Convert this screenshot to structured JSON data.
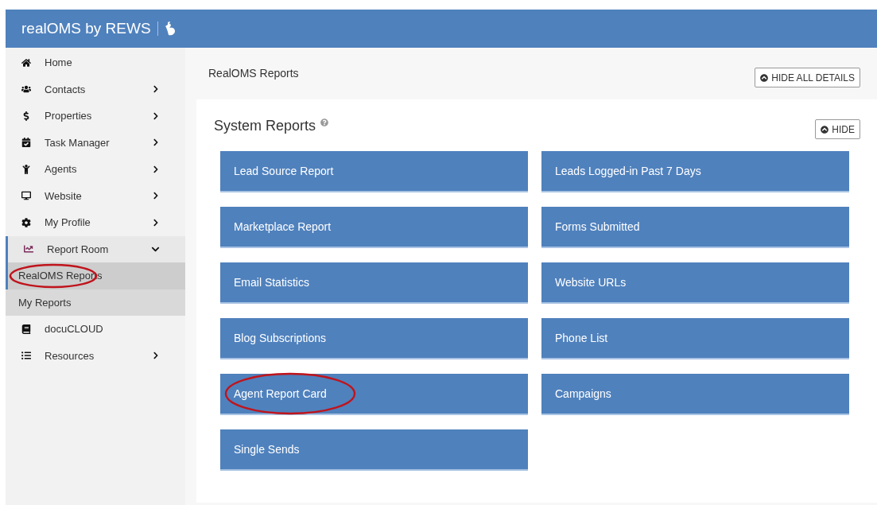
{
  "header": {
    "brand": "realOMS by REWS"
  },
  "sidebar": {
    "items": [
      {
        "label": "Home"
      },
      {
        "label": "Contacts",
        "expanded": false
      },
      {
        "label": "Properties",
        "expanded": false
      },
      {
        "label": "Task Manager",
        "expanded": false
      },
      {
        "label": "Agents",
        "expanded": false
      },
      {
        "label": "Website",
        "expanded": false
      },
      {
        "label": "My Profile",
        "expanded": false
      },
      {
        "label": "Report Room",
        "expanded": true,
        "children": [
          {
            "label": "RealOMS Reports",
            "selected": true,
            "circled": true
          },
          {
            "label": "My Reports",
            "selected": false,
            "circled": false
          }
        ]
      },
      {
        "label": "docuCLOUD"
      },
      {
        "label": "Resources",
        "expanded": false
      }
    ]
  },
  "page": {
    "breadcrumb": "RealOMS Reports",
    "hide_all_button": "HIDE ALL DETAILS"
  },
  "panel": {
    "title": "System Reports",
    "hide_button": "HIDE",
    "reports": [
      {
        "label": "Lead Source Report",
        "circled": false
      },
      {
        "label": "Leads Logged-in Past 7 Days",
        "circled": false
      },
      {
        "label": "Marketplace Report",
        "circled": false
      },
      {
        "label": "Forms Submitted",
        "circled": false
      },
      {
        "label": "Email Statistics",
        "circled": false
      },
      {
        "label": "Website URLs",
        "circled": false
      },
      {
        "label": "Blog Subscriptions",
        "circled": false
      },
      {
        "label": "Phone List",
        "circled": false
      },
      {
        "label": "Agent Report Card",
        "circled": true
      },
      {
        "label": "Campaigns",
        "circled": false
      },
      {
        "label": "Single Sends",
        "circled": false
      }
    ]
  }
}
